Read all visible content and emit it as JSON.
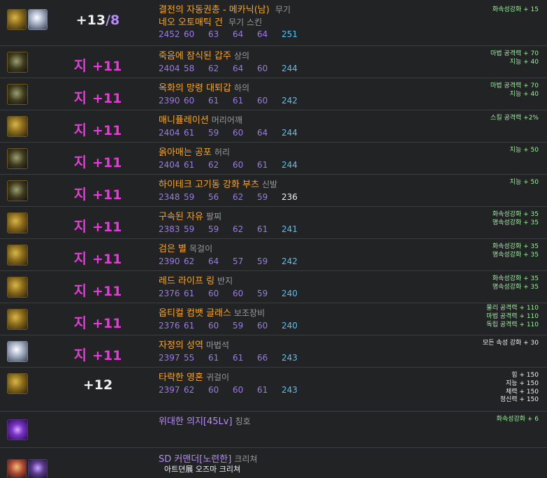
{
  "items": [
    {
      "icons": [
        "gun-icon",
        "cube-icon"
      ],
      "enhance": {
        "prefix": "",
        "plus": "+13",
        "amp": "/8"
      },
      "name": "결전의 자동권총 - 메카닉(남)",
      "slot": "무기",
      "name2": "네오 오토매틱 건",
      "slot2": "무기 스킨",
      "stats": [
        "2452",
        "60",
        "63",
        "64",
        "64",
        "251"
      ],
      "options": [
        "화속성강화 + 15"
      ]
    },
    {
      "icons": [
        "robe-icon"
      ],
      "enhance": {
        "prefix": "지",
        "plus": "+11"
      },
      "name": "죽음에 잠식된 갑주",
      "slot": "상의",
      "stats": [
        "2404",
        "58",
        "62",
        "64",
        "60",
        "244"
      ],
      "options": [
        "마법 공격력 + 70",
        "지능 + 40"
      ]
    },
    {
      "icons": [
        "pants-icon"
      ],
      "enhance": {
        "prefix": "지",
        "plus": "+11"
      },
      "name": "옥화의 망령 대퇴갑",
      "slot": "하의",
      "stats": [
        "2390",
        "60",
        "61",
        "61",
        "60",
        "242"
      ],
      "options": [
        "마법 공격력 + 70",
        "지능 + 40"
      ]
    },
    {
      "icons": [
        "shoulder-icon"
      ],
      "enhance": {
        "prefix": "지",
        "plus": "+11"
      },
      "name": "매니퓰레이션",
      "slot": "머리어깨",
      "stats": [
        "2404",
        "61",
        "59",
        "60",
        "64",
        "244"
      ],
      "options": [
        "스킬 공격력 +2%"
      ]
    },
    {
      "icons": [
        "belt-icon"
      ],
      "enhance": {
        "prefix": "지",
        "plus": "+11"
      },
      "name": "옭아매는 공포",
      "slot": "허리",
      "stats": [
        "2404",
        "61",
        "62",
        "60",
        "61",
        "244"
      ],
      "options": [
        "지능 + 50"
      ]
    },
    {
      "icons": [
        "boots-icon"
      ],
      "enhance": {
        "prefix": "지",
        "plus": "+11"
      },
      "name": "하이테크 고기동 강화 부츠",
      "slot": "신발",
      "stats": [
        "2348",
        "59",
        "56",
        "62",
        "59",
        "236"
      ],
      "options": [
        "지능 + 50"
      ]
    },
    {
      "icons": [
        "bracelet-icon"
      ],
      "enhance": {
        "prefix": "지",
        "plus": "+11"
      },
      "name": "구속된 자유",
      "slot": "팔찌",
      "stats": [
        "2383",
        "59",
        "59",
        "62",
        "61",
        "241"
      ],
      "options": [
        "화속성강화 + 35",
        "명속성강화 + 35"
      ]
    },
    {
      "icons": [
        "necklace-icon"
      ],
      "enhance": {
        "prefix": "지",
        "plus": "+11"
      },
      "name": "검은 별",
      "slot": "목걸이",
      "stats": [
        "2390",
        "62",
        "64",
        "57",
        "59",
        "242"
      ],
      "options": [
        "화속성강화 + 35",
        "명속성강화 + 35"
      ]
    },
    {
      "icons": [
        "ring-icon"
      ],
      "enhance": {
        "prefix": "지",
        "plus": "+11"
      },
      "name": "레드 라이프 링",
      "slot": "반지",
      "stats": [
        "2376",
        "61",
        "60",
        "60",
        "59",
        "240"
      ],
      "options": [
        "화속성강화 + 35",
        "명속성강화 + 35"
      ]
    },
    {
      "icons": [
        "goggles-icon"
      ],
      "enhance": {
        "prefix": "지",
        "plus": "+11"
      },
      "name": "옵티컬 컴뱃 글래스",
      "slot": "보조장비",
      "stats": [
        "2376",
        "61",
        "60",
        "59",
        "60",
        "240"
      ],
      "options": [
        "물리 공격력 + 110",
        "마법 공격력 + 110",
        "독립 공격력 + 110"
      ]
    },
    {
      "icons": [
        "gem-icon"
      ],
      "enhance": {
        "prefix": "지",
        "plus": "+11"
      },
      "name": "자정의 성역",
      "slot": "마법석",
      "stats": [
        "2397",
        "55",
        "61",
        "61",
        "66",
        "243"
      ],
      "options": [
        "모든 속성 강화 + 30"
      ]
    },
    {
      "icons": [
        "earring-icon"
      ],
      "enhance": {
        "prefix": "",
        "plus": "+12"
      },
      "name": "타락한 영혼",
      "slot": "귀걸이",
      "stats": [
        "2397",
        "62",
        "60",
        "60",
        "61",
        "243"
      ],
      "options": [
        "힘 + 150",
        "지능 + 150",
        "체력 + 150",
        "정신력 + 150"
      ]
    },
    {
      "icons": [
        "title-icon"
      ],
      "name": "위대한 의지[45Lv]",
      "slot": "칭호",
      "options": [
        "화속성강화 + 6"
      ]
    },
    {
      "icons": [
        "creature-icon",
        "artifact-icon"
      ],
      "name": "SD 커맨더[노련한]",
      "slot": "크리쳐",
      "extra": "아트뎐展 오즈마 크리쳐"
    }
  ]
}
